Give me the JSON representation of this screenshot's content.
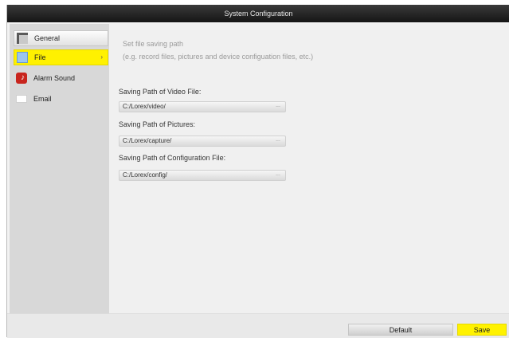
{
  "window": {
    "title": "System Configuration"
  },
  "sidebar": {
    "items": [
      {
        "label": "General",
        "icon": "general-settings-icon"
      },
      {
        "label": "File",
        "icon": "file-folder-icon",
        "selected": true
      },
      {
        "label": "Alarm Sound",
        "icon": "alarm-sound-icon"
      },
      {
        "label": "Email",
        "icon": "email-icon"
      }
    ]
  },
  "main": {
    "hint_title": "Set file saving path",
    "hint_detail": "(e.g. record files, pictures and device configuation files, etc.)",
    "video_path": {
      "label": "Saving Path of Video File:",
      "value": "C:/Lorex/video/"
    },
    "pictures_path": {
      "label": "Saving Path of Pictures:",
      "value": "C:/Lorex/capture/"
    },
    "config_path": {
      "label": "Saving Path of Configuration File:",
      "value": "C:/Lorex/config/"
    },
    "browse_glyph": "..."
  },
  "footer": {
    "default_label": "Default",
    "save_label": "Save"
  },
  "colors": {
    "accent": "#fff200",
    "titlebar": "#1e1e1e"
  }
}
